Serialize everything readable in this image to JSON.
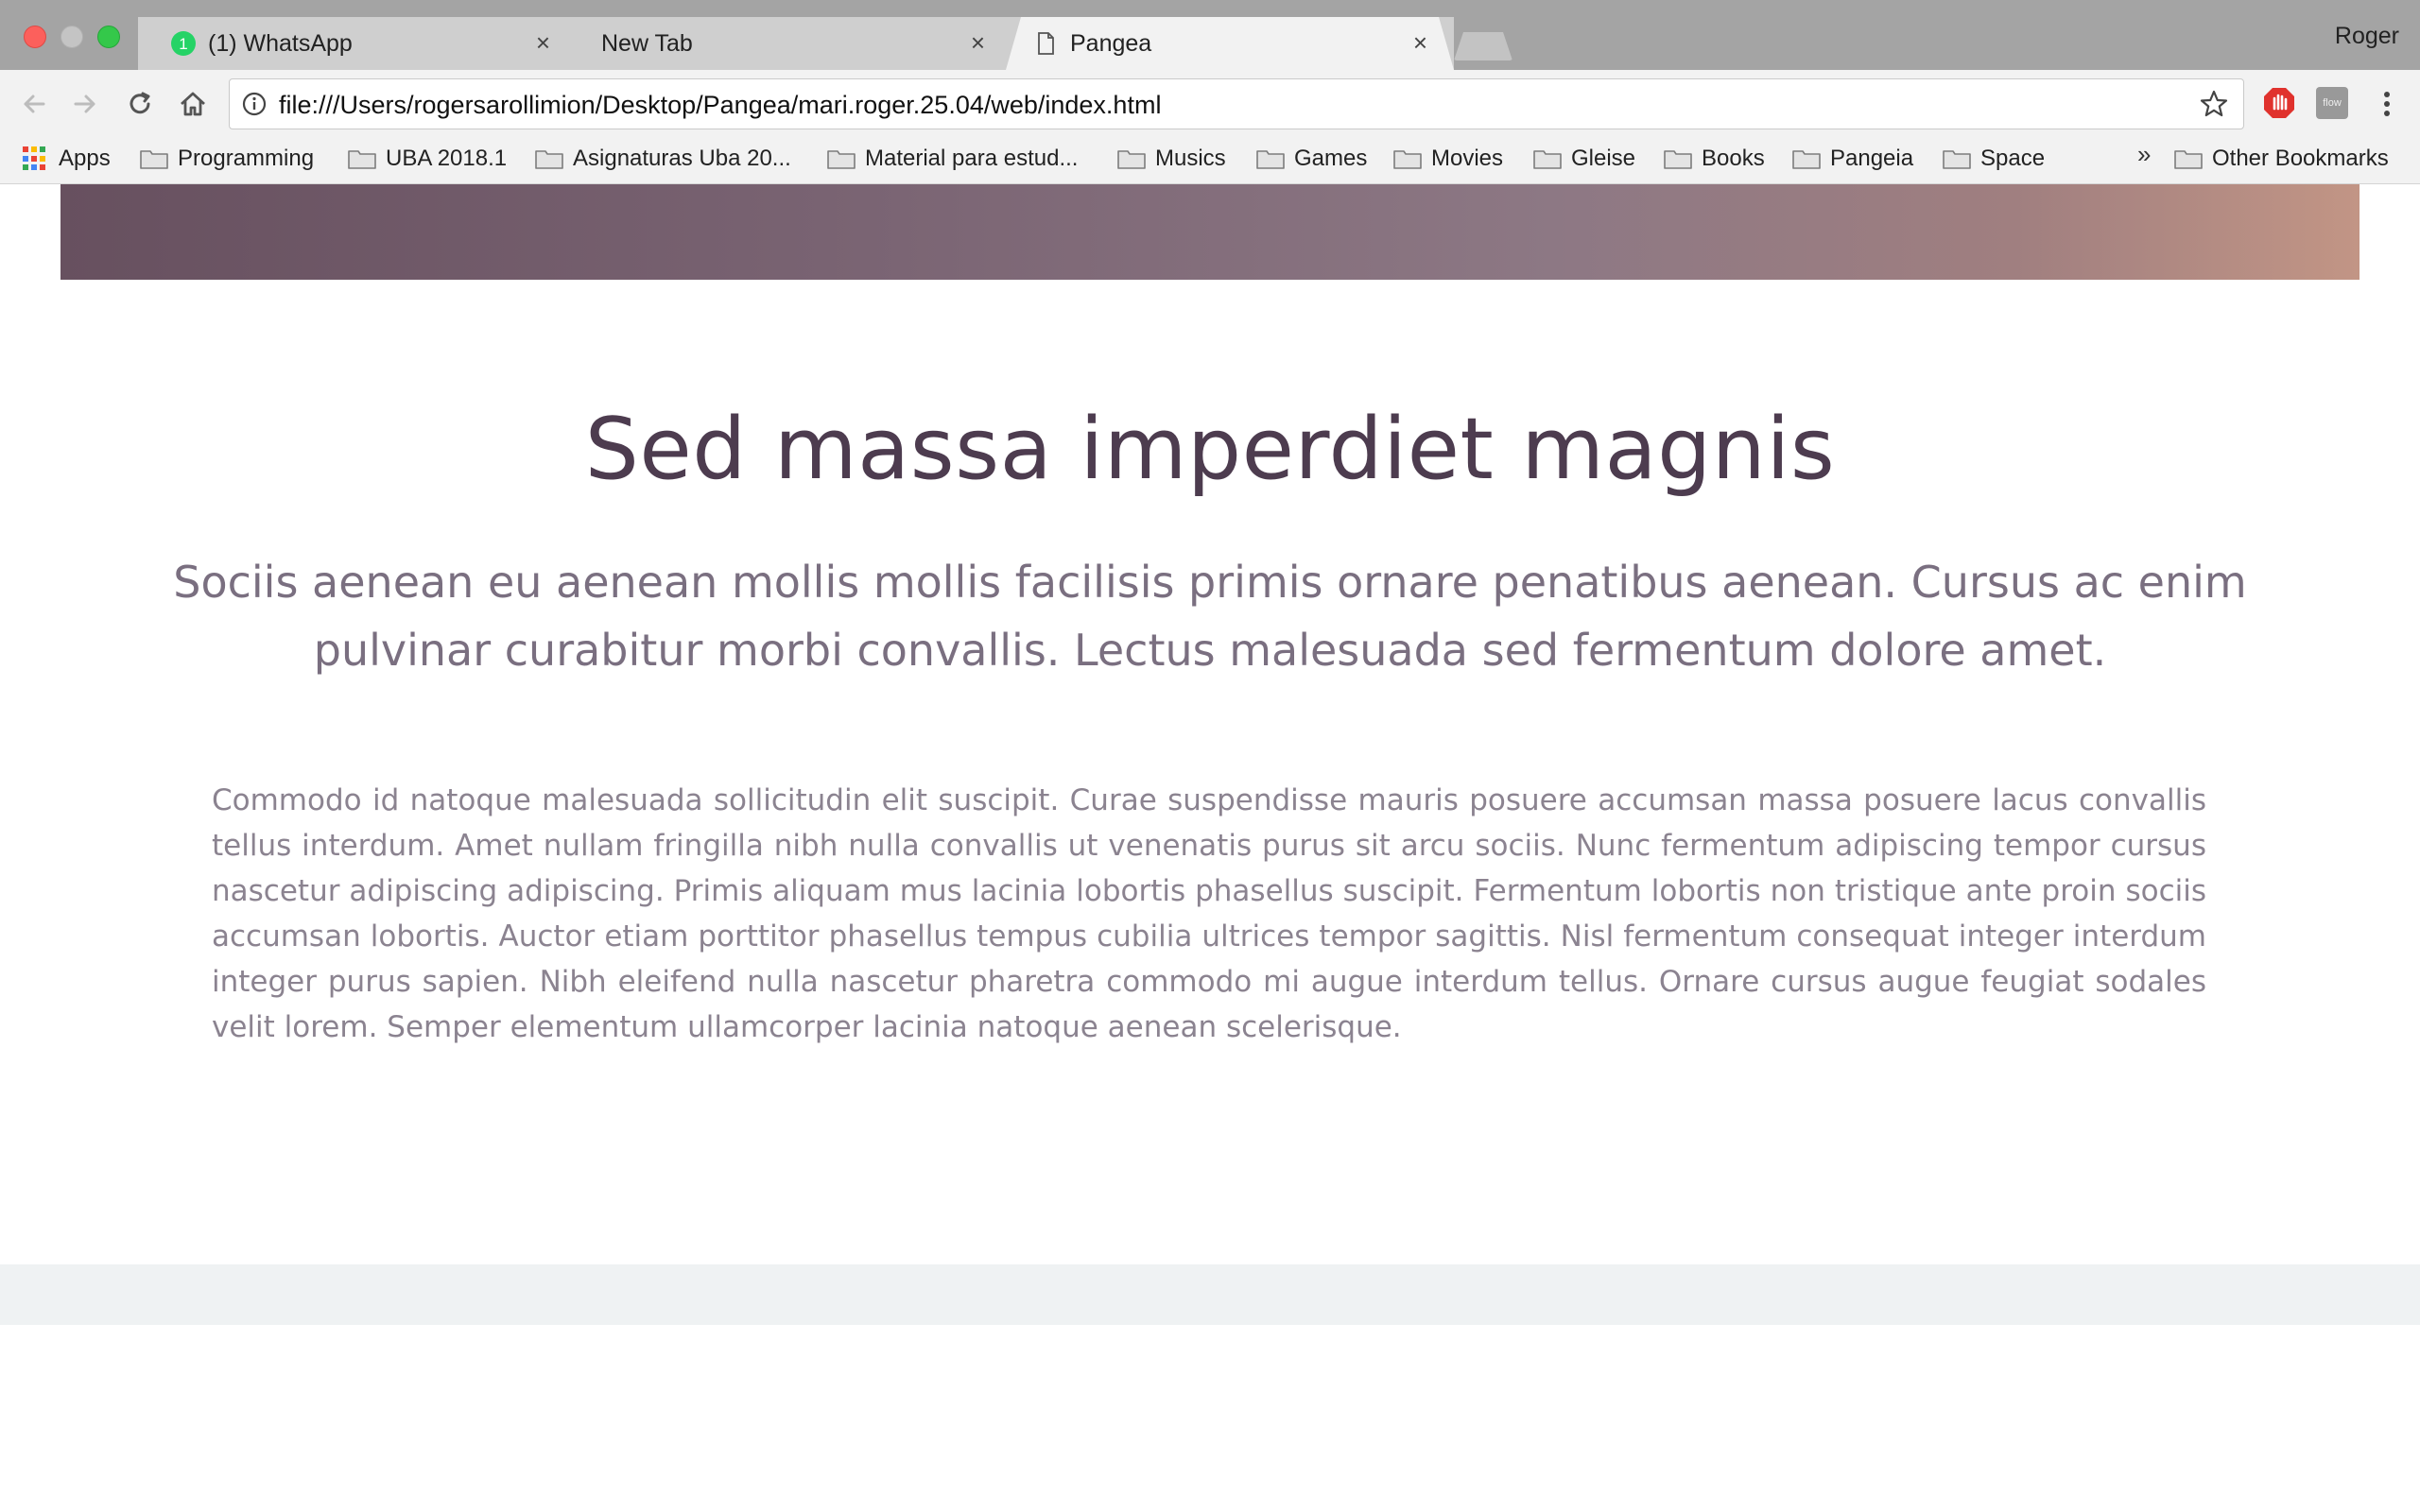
{
  "browser": {
    "tabs": [
      {
        "label": "(1) WhatsApp",
        "badge": "1",
        "active": false
      },
      {
        "label": "New Tab",
        "active": false
      },
      {
        "label": "Pangea",
        "active": true
      }
    ],
    "tab_close_glyph": "×",
    "profile_name": "Roger",
    "url": "file:///Users/rogersarollimion/Desktop/Pangea/mari.roger.25.04/web/index.html",
    "extension_label": "flow",
    "bookmarks": [
      {
        "label": "Apps",
        "icon": "apps-grid-icon"
      },
      {
        "label": "Programming",
        "icon": "folder-icon"
      },
      {
        "label": "UBA 2018.1",
        "icon": "folder-icon"
      },
      {
        "label": "Asignaturas Uba 20...",
        "icon": "folder-icon"
      },
      {
        "label": "Material para estud...",
        "icon": "folder-icon"
      },
      {
        "label": "Musics",
        "icon": "folder-icon"
      },
      {
        "label": "Games",
        "icon": "folder-icon"
      },
      {
        "label": "Movies",
        "icon": "folder-icon"
      },
      {
        "label": "Gleise",
        "icon": "folder-icon"
      },
      {
        "label": "Books",
        "icon": "folder-icon"
      },
      {
        "label": "Pangeia",
        "icon": "folder-icon"
      },
      {
        "label": "Space",
        "icon": "folder-icon"
      }
    ],
    "overflow_chevron": "»",
    "other_bookmarks": "Other Bookmarks"
  },
  "page": {
    "heading": "Sed massa imperdiet magnis",
    "subtitle": "Sociis aenean eu aenean mollis mollis facilisis primis ornare penatibus aenean. Cursus ac enim pulvinar curabitur morbi convallis. Lectus malesuada sed fermentum dolore amet.",
    "body": "Commodo id natoque malesuada sollicitudin elit suscipit. Curae suspendisse mauris posuere accumsan massa posuere lacus convallis tellus interdum. Amet nullam fringilla nibh nulla convallis ut venenatis purus sit arcu sociis. Nunc fermentum adipiscing tempor cursus nascetur adipiscing adipiscing. Primis aliquam mus lacinia lobortis phasellus suscipit. Fermentum lobortis non tristique ante proin sociis accumsan lobortis. Auctor etiam porttitor phasellus tempus cubilia ultrices tempor sagittis. Nisl fermentum consequat integer interdum integer purus sapien. Nibh eleifend nulla nascetur pharetra commodo mi augue interdum tellus. Ornare cursus augue feugiat sodales velit lorem. Semper elementum ullamcorper lacinia natoque aenean scelerisque."
  },
  "colors": {
    "heading": "#4d3c4f",
    "subtitle": "#7a6f80",
    "body": "#8b8390",
    "footer_band": "#eff2f3",
    "whatsapp_badge": "#25d366"
  }
}
